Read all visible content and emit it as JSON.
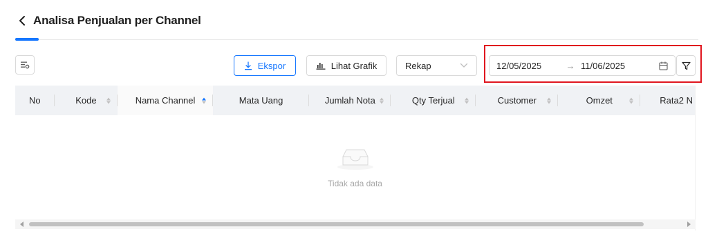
{
  "header": {
    "title": "Analisa Penjualan per Channel",
    "back_icon": "chevron-left-icon"
  },
  "toolbar": {
    "column_settings_icon": "column-settings-icon",
    "export_label": "Ekspor",
    "export_icon": "download-icon",
    "chart_label": "Lihat Grafik",
    "chart_icon": "bar-chart-icon",
    "mode_select_value": "Rekap",
    "date_start": "12/05/2025",
    "date_separator": "→",
    "date_end": "11/06/2025",
    "calendar_icon": "calendar-icon",
    "filter_icon": "filter-icon"
  },
  "table": {
    "columns": [
      {
        "label": "No",
        "sortable": false
      },
      {
        "label": "Kode",
        "sortable": true
      },
      {
        "label": "Nama Channel",
        "sortable": true,
        "sort": "ascend"
      },
      {
        "label": "Mata Uang",
        "sortable": false
      },
      {
        "label": "Jumlah Nota",
        "sortable": true
      },
      {
        "label": "Qty Terjual",
        "sortable": true
      },
      {
        "label": "Customer",
        "sortable": true
      },
      {
        "label": "Omzet",
        "sortable": true
      },
      {
        "label": "Rata2 N",
        "sortable": false
      }
    ],
    "rows": [],
    "empty_text": "Tidak ada data"
  },
  "colors": {
    "primary": "#1677ff",
    "highlight": "#e0141e",
    "header_bg": "#f0f2f5"
  }
}
